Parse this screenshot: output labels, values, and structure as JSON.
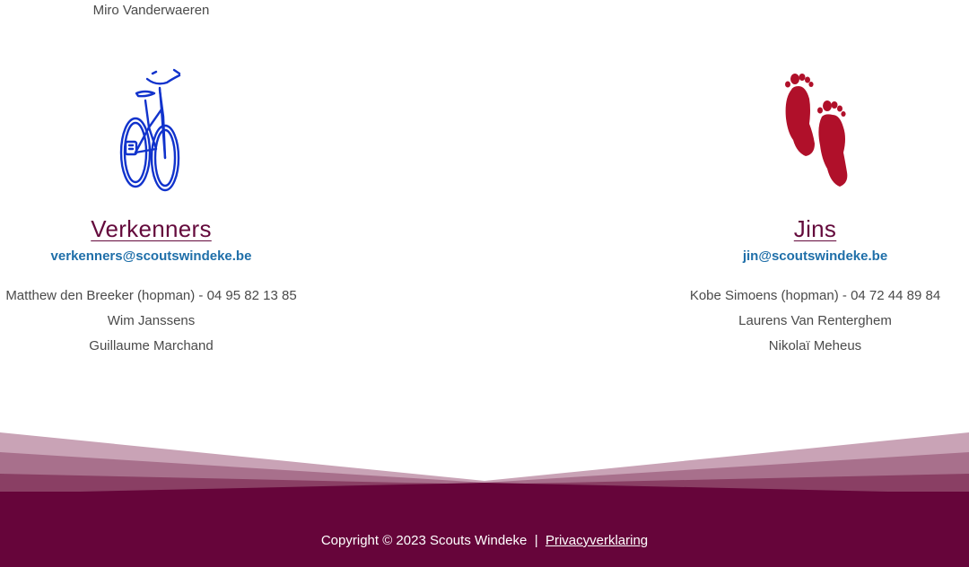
{
  "top_name": "Miro Vanderwaeren",
  "groups": [
    {
      "title": "Verkenners",
      "email": "verkenners@scoutswindeke.be",
      "members": [
        "Matthew den Breeker (hopman) - 04 95 82 13 85",
        "Wim Janssens",
        "Guillaume Marchand"
      ],
      "icon": "bicycle-icon"
    },
    {
      "title": "Jins",
      "email": "jin@scoutswindeke.be",
      "members": [
        "Kobe Simoens (hopman) - 04 72 44 89 84",
        "Laurens Van Renterghem",
        "Nikolaï Meheus"
      ],
      "icon": "footprints-icon"
    }
  ],
  "footer": {
    "copyright": "Copyright © 2023 Scouts Windeke",
    "separator": "|",
    "privacy_label": "Privacyverklaring"
  },
  "colors": {
    "brand": "#66053a",
    "email": "#1f6fa9",
    "bicycle": "#1133cc",
    "feet": "#b0102a"
  }
}
